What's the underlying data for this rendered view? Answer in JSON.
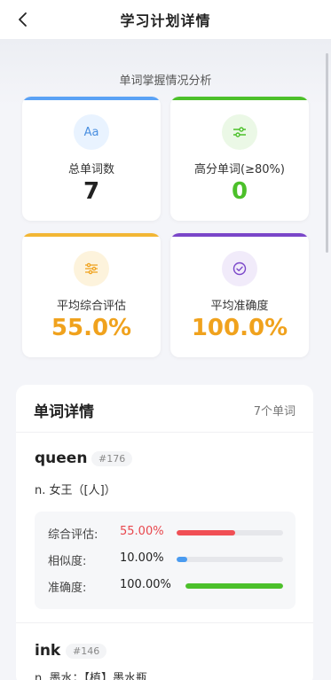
{
  "nav": {
    "title": "学习计划详情",
    "back_icon": "chevron-left-icon"
  },
  "analysis": {
    "title": "单词掌握情况分析",
    "cards": [
      {
        "label": "总单词数",
        "value": "7",
        "icon": "aa-text-icon",
        "icon_text": "Aa",
        "accent": "#5aa2f5",
        "value_color": "#222222",
        "icon_bg": "#e9f3ff"
      },
      {
        "label": "高分单词(≥80%)",
        "value": "0",
        "icon": "sliders-icon",
        "accent": "#4cc02a",
        "value_color": "#4cc02a",
        "icon_bg": "#ebf8e6"
      },
      {
        "label": "平均综合评估",
        "value": "55.0%",
        "icon": "sliders-icon",
        "accent": "#f2b634",
        "value_color": "#f0a21d",
        "icon_bg": "#fdf3dc"
      },
      {
        "label": "平均准确度",
        "value": "100.0%",
        "icon": "check-circle-icon",
        "accent": "#7a46c9",
        "value_color": "#f0a21d",
        "icon_bg": "#f1ebfa"
      }
    ]
  },
  "details": {
    "title": "单词详情",
    "count": "7个单词",
    "words": [
      {
        "word": "queen",
        "id": "#176",
        "meaning": "n. 女王（[人]）",
        "stats": [
          {
            "name": "综合评估:",
            "value": "55.00%",
            "fraction": 0.55,
            "color": "#f04f55",
            "value_color": "#e8474d"
          },
          {
            "name": "相似度:",
            "value": "10.00%",
            "fraction": 0.1,
            "color": "#4a9bf0",
            "value_color": "#222222"
          },
          {
            "name": "准确度:",
            "value": "100.00%",
            "fraction": 1.0,
            "color": "#4cc02a",
            "value_color": "#222222"
          }
        ]
      },
      {
        "word": "ink",
        "id": "#146",
        "meaning": "n. 墨水；【植】墨水瓶"
      }
    ]
  }
}
